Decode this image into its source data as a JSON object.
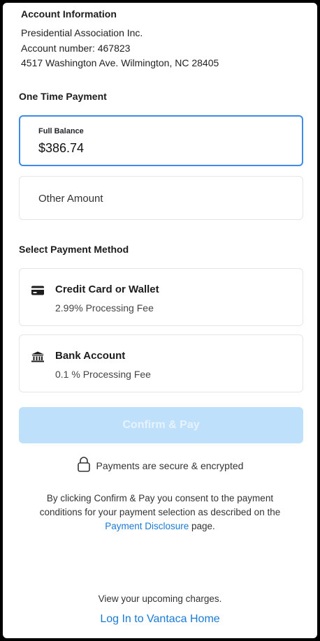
{
  "account": {
    "heading": "Account Information",
    "name": "Presidential Association Inc.",
    "number_line": "Account number:  467823",
    "address": "4517 Washington Ave. Wilmington, NC 28405"
  },
  "payment": {
    "heading": "One Time Payment",
    "full_balance_label": "Full Balance",
    "full_balance_amount": "$386.74",
    "other_amount_label": "Other Amount"
  },
  "methods": {
    "heading": "Select Payment Method",
    "items": [
      {
        "icon": "credit-card-icon",
        "title": "Credit Card or Wallet",
        "fee": "2.99%  Processing Fee"
      },
      {
        "icon": "bank-icon",
        "title": "Bank Account",
        "fee": "0.1 %  Processing Fee"
      }
    ]
  },
  "confirm": {
    "label": "Confirm & Pay",
    "enabled": false
  },
  "secure": {
    "icon": "lock-icon",
    "text": "Payments are secure & encrypted"
  },
  "consent": {
    "text_before": "By clicking Confirm & Pay you consent to the payment conditions for your payment selection as described on the ",
    "link": "Payment Disclosure",
    "text_after": " page."
  },
  "footer": {
    "upcoming": "View your upcoming charges.",
    "login_link": "Log In to Vantaca Home"
  },
  "colors": {
    "accent": "#3d8be8",
    "link": "#1a7ad4",
    "confirm_disabled_bg": "#bfe0fb"
  }
}
